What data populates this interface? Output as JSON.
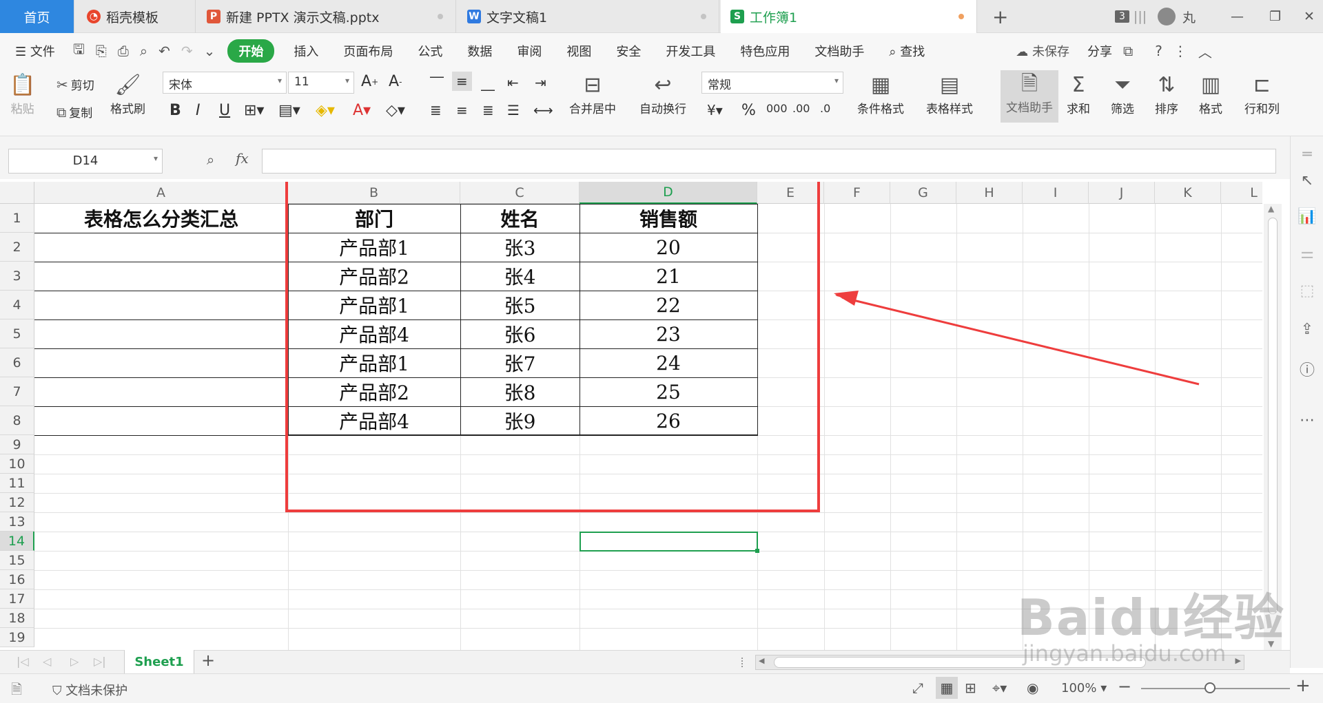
{
  "tabs": {
    "home": "首页",
    "template": "稻壳模板",
    "pptx": "新建 PPTX 演示文稿.pptx",
    "doc": "文字文稿1",
    "sheet": "工作簿1",
    "badge": "3",
    "user": "丸"
  },
  "menu": {
    "file": "文件",
    "items": [
      "开始",
      "插入",
      "页面布局",
      "公式",
      "数据",
      "审阅",
      "视图",
      "安全",
      "开发工具",
      "特色应用",
      "文档助手"
    ],
    "search": "查找",
    "unsaved": "未保存",
    "share": "分享"
  },
  "ribbon": {
    "paste": "粘贴",
    "cut": "剪切",
    "copy": "复制",
    "format_painter": "格式刷",
    "font_name": "宋体",
    "font_size": "11",
    "merge_center": "合并居中",
    "wrap_text": "自动换行",
    "number_format": "常规",
    "conditional_format": "条件格式",
    "table_style": "表格样式",
    "doc_assistant": "文档助手",
    "sum": "求和",
    "filter": "筛选",
    "sort": "排序",
    "format": "格式",
    "rows_cols": "行和列"
  },
  "formula_bar": {
    "name_box": "D14",
    "fx": "fx",
    "value": ""
  },
  "columns": [
    "A",
    "B",
    "C",
    "D",
    "E",
    "F",
    "G",
    "H",
    "I",
    "J",
    "K",
    "L"
  ],
  "rows": [
    "1",
    "2",
    "3",
    "4",
    "5",
    "6",
    "7",
    "8",
    "9",
    "10",
    "11",
    "12",
    "13",
    "14",
    "15",
    "16",
    "17",
    "18",
    "19"
  ],
  "selected_cell": "D14",
  "cells": {
    "A1": "表格怎么分类汇总",
    "header": [
      "部门",
      "姓名",
      "销售额"
    ],
    "data": [
      [
        "产品部1",
        "张3",
        "20"
      ],
      [
        "产品部2",
        "张4",
        "21"
      ],
      [
        "产品部1",
        "张5",
        "22"
      ],
      [
        "产品部4",
        "张6",
        "23"
      ],
      [
        "产品部1",
        "张7",
        "24"
      ],
      [
        "产品部2",
        "张8",
        "25"
      ],
      [
        "产品部4",
        "张9",
        "26"
      ]
    ]
  },
  "sheet_tabs": [
    "Sheet1"
  ],
  "status": {
    "protection": "文档未保护",
    "zoom": "100%"
  },
  "watermark": {
    "brand": "Baidu经验",
    "url": "jingyan.baidu.com"
  },
  "colors": {
    "accent_green": "#1e9f4f",
    "home_tab_blue": "#2e87e0",
    "annotation_red": "#ee3d3d"
  }
}
